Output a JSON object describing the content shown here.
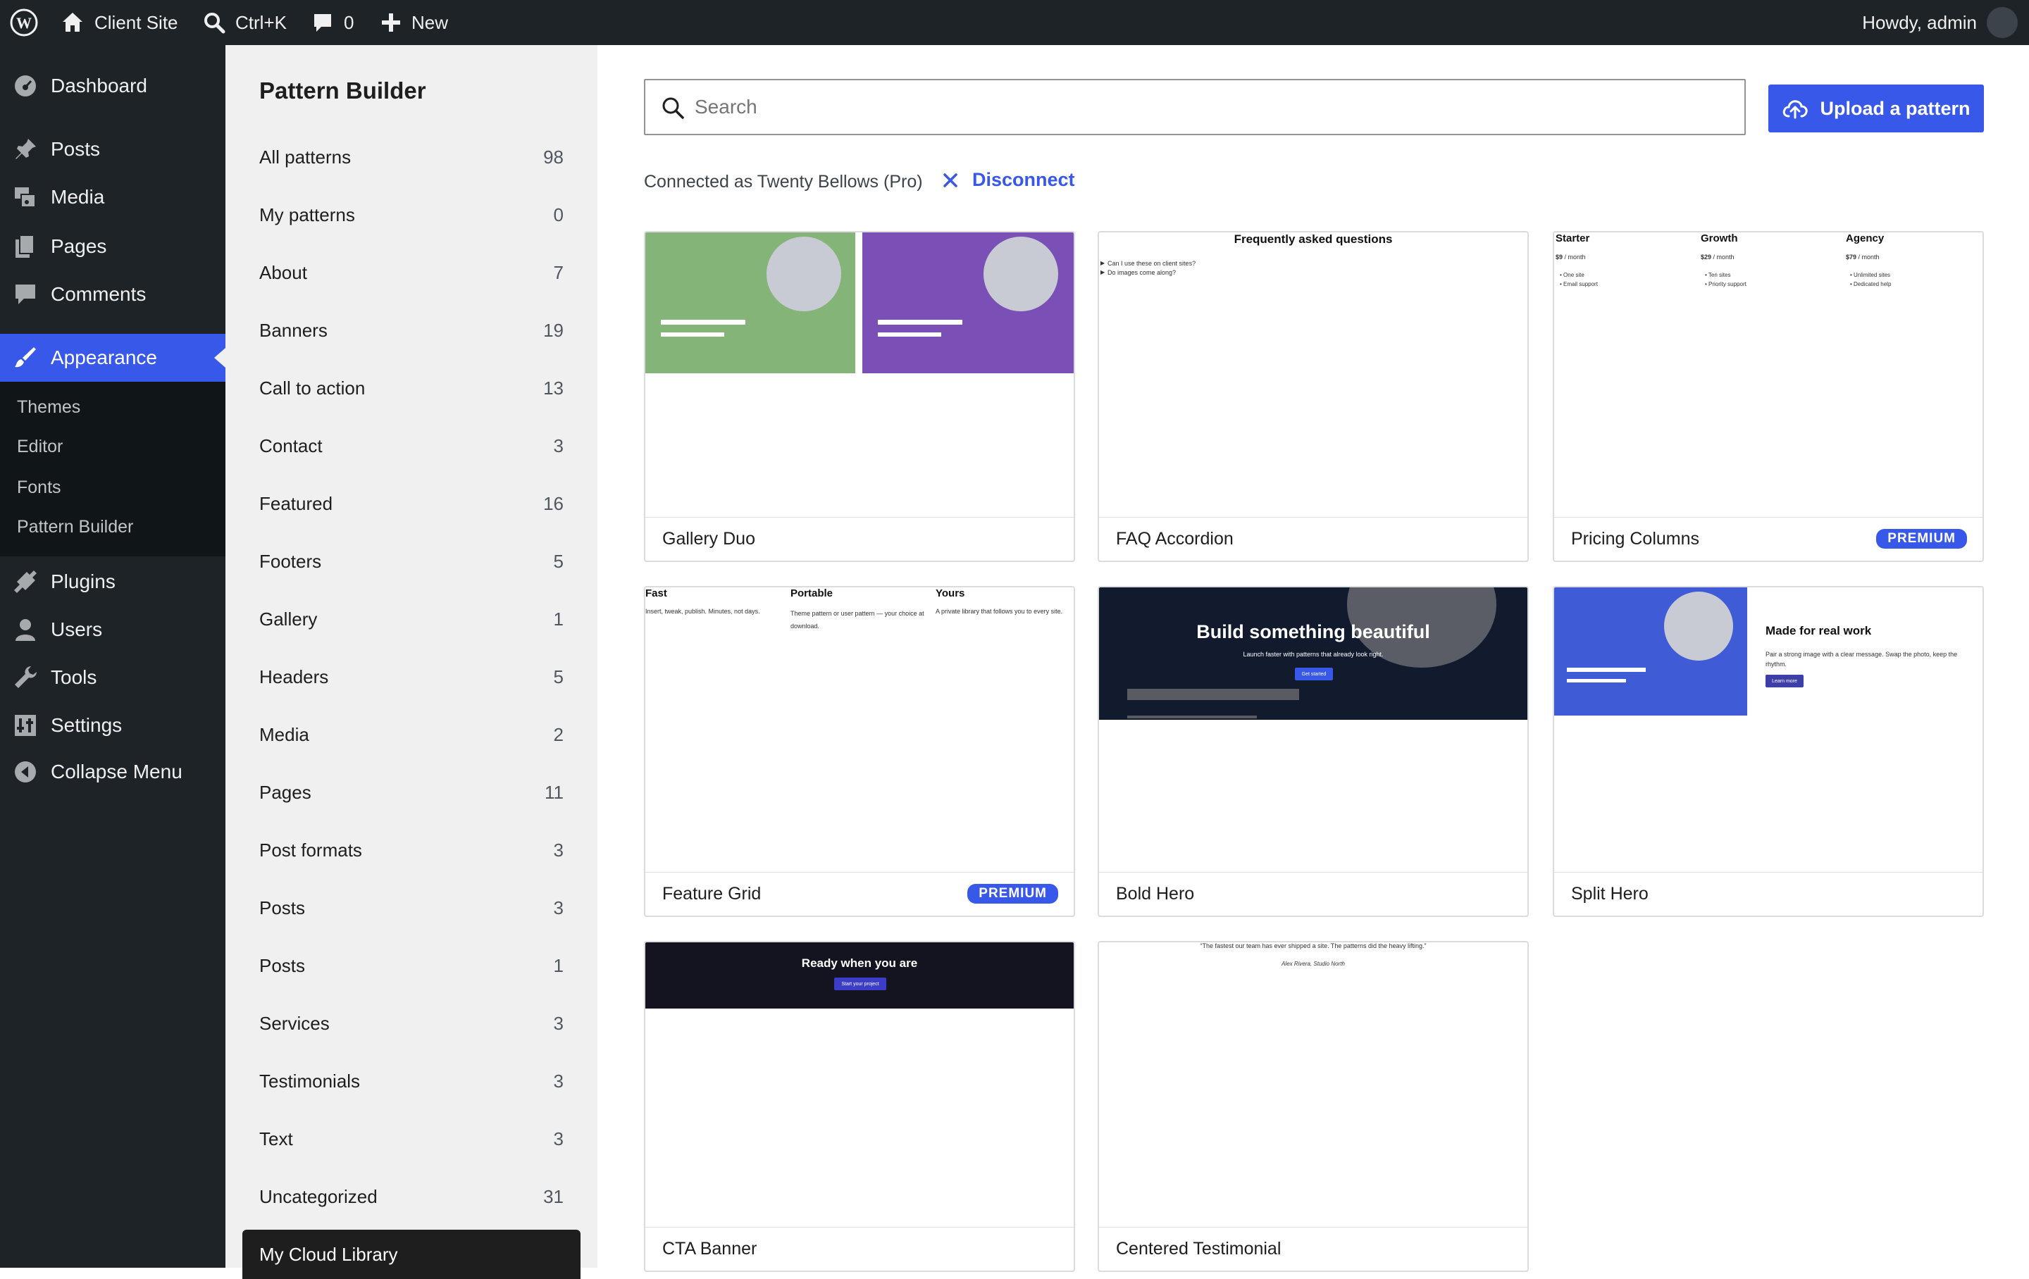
{
  "adminbar": {
    "site_name": "Client Site",
    "shortcut": "Ctrl+K",
    "comments_count": "0",
    "new_label": "New",
    "greeting": "Howdy, admin"
  },
  "sidebar": {
    "items": [
      {
        "label": "Dashboard",
        "icon": "dashboard-icon"
      },
      {
        "label": "Posts",
        "icon": "pin-icon"
      },
      {
        "label": "Media",
        "icon": "media-icon"
      },
      {
        "label": "Pages",
        "icon": "pages-icon"
      },
      {
        "label": "Comments",
        "icon": "comment-icon"
      },
      {
        "label": "Appearance",
        "icon": "paintbrush-icon"
      },
      {
        "label": "Plugins",
        "icon": "plugin-icon"
      },
      {
        "label": "Users",
        "icon": "user-icon"
      },
      {
        "label": "Tools",
        "icon": "wrench-icon"
      },
      {
        "label": "Settings",
        "icon": "settings-icon"
      },
      {
        "label": "Collapse Menu",
        "icon": "collapse-icon"
      }
    ],
    "submenu": [
      "Themes",
      "Editor",
      "Fonts",
      "Pattern Builder"
    ]
  },
  "pattern_builder": {
    "title": "Pattern Builder",
    "categories": [
      {
        "label": "All patterns",
        "count": "98"
      },
      {
        "label": "My patterns",
        "count": "0"
      },
      {
        "label": "About",
        "count": "7"
      },
      {
        "label": "Banners",
        "count": "19"
      },
      {
        "label": "Call to action",
        "count": "13"
      },
      {
        "label": "Contact",
        "count": "3"
      },
      {
        "label": "Featured",
        "count": "16"
      },
      {
        "label": "Footers",
        "count": "5"
      },
      {
        "label": "Gallery",
        "count": "1"
      },
      {
        "label": "Headers",
        "count": "5"
      },
      {
        "label": "Media",
        "count": "2"
      },
      {
        "label": "Pages",
        "count": "11"
      },
      {
        "label": "Post formats",
        "count": "3"
      },
      {
        "label": "Posts",
        "count": "3"
      },
      {
        "label": "Posts",
        "count": "1"
      },
      {
        "label": "Services",
        "count": "3"
      },
      {
        "label": "Testimonials",
        "count": "3"
      },
      {
        "label": "Text",
        "count": "3"
      },
      {
        "label": "Uncategorized",
        "count": "31"
      }
    ],
    "cloud_tab": "My Cloud Library"
  },
  "main": {
    "search_placeholder": "Search",
    "upload_label": "Upload a pattern",
    "connected_text": "Connected as Twenty Bellows (Pro)",
    "disconnect_label": "Disconnect",
    "premium_label": "PREMIUM",
    "cards": [
      {
        "title": "Gallery Duo",
        "premium": false
      },
      {
        "title": "FAQ Accordion",
        "premium": false
      },
      {
        "title": "Pricing Columns",
        "premium": true
      },
      {
        "title": "Feature Grid",
        "premium": true
      },
      {
        "title": "Bold Hero",
        "premium": false
      },
      {
        "title": "Split Hero",
        "premium": false
      },
      {
        "title": "CTA Banner",
        "premium": false
      },
      {
        "title": "Centered Testimonial",
        "premium": false
      }
    ],
    "previews": {
      "faq": {
        "title": "Frequently asked questions",
        "q1": "Can I use these on client sites?",
        "q2": "Do images come along?"
      },
      "pricing": {
        "plans": [
          {
            "name": "Starter",
            "price": "$9",
            "per": "/ month",
            "f1": "One site",
            "f2": "Email support"
          },
          {
            "name": "Growth",
            "price": "$29",
            "per": "/ month",
            "f1": "Ten sites",
            "f2": "Priority support"
          },
          {
            "name": "Agency",
            "price": "$79",
            "per": "/ month",
            "f1": "Unlimited sites",
            "f2": "Dedicated help"
          }
        ]
      },
      "features": [
        {
          "name": "Fast",
          "text": "Insert, tweak, publish. Minutes, not days."
        },
        {
          "name": "Portable",
          "text": "Theme pattern or user pattern — your choice at download."
        },
        {
          "name": "Yours",
          "text": "A private library that follows you to every site."
        }
      ],
      "bold_hero": {
        "heading": "Build something beautiful",
        "sub": "Launch faster with patterns that already look right.",
        "button": "Get started"
      },
      "split_hero": {
        "heading": "Made for real work",
        "text": "Pair a strong image with a clear message. Swap the photo, keep the rhythm.",
        "button": "Learn more"
      },
      "cta": {
        "heading": "Ready when you are",
        "button": "Start your project"
      },
      "testimonial": {
        "quote": "“The fastest our team has ever shipped a site. The patterns did the heavy lifting.”",
        "author": "Alex Rivera, Studio North"
      }
    }
  },
  "colors": {
    "accent": "#3858e9",
    "admin_dark": "#1d2327",
    "gallery_green": "#84b477",
    "gallery_purple": "#7a4fb6",
    "hero_navy": "#121a2e",
    "split_blue": "#3f5bd6",
    "cta_dark": "#13141f"
  }
}
